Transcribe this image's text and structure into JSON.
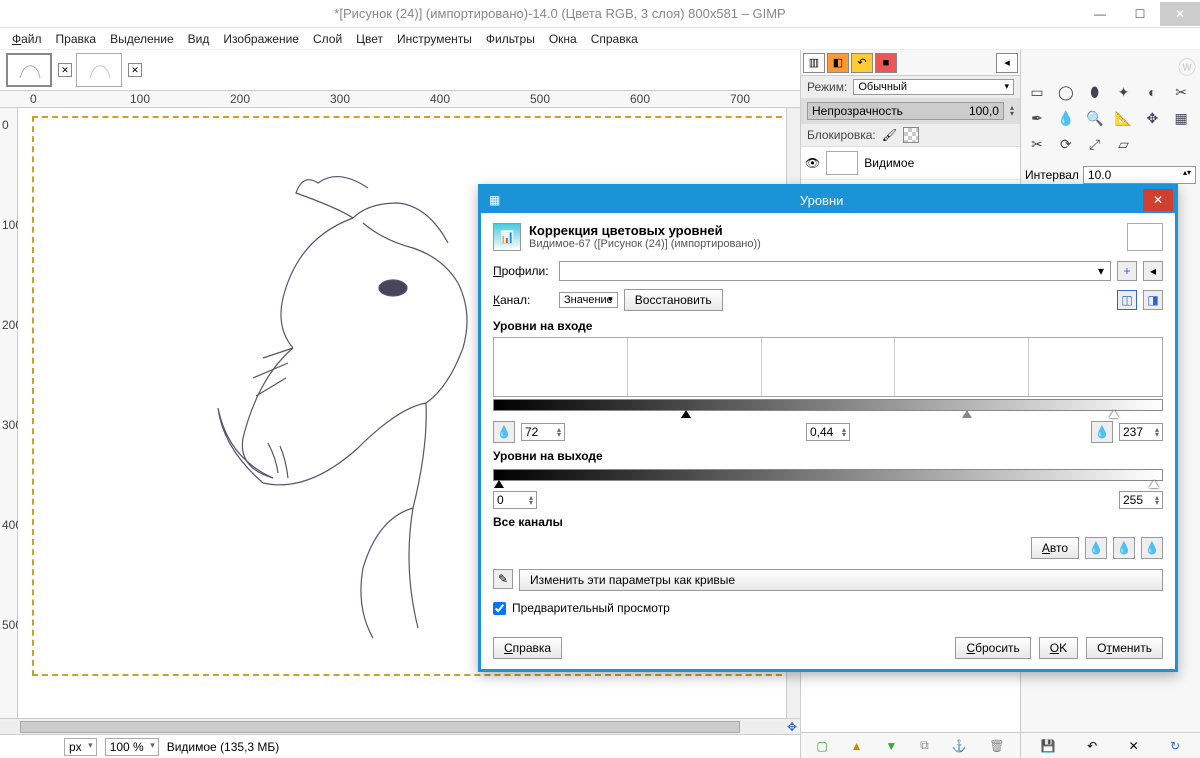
{
  "window": {
    "title": "*[Рисунок (24)] (импортировано)-14.0 (Цвета RGB, 3 слоя) 800x581 – GIMP"
  },
  "menu": {
    "file": "Файл",
    "edit": "Правка",
    "select": "Выделение",
    "view": "Вид",
    "image": "Изображение",
    "layer": "Слой",
    "color": "Цвет",
    "tools": "Инструменты",
    "filters": "Фильтры",
    "windows": "Окна",
    "help": "Справка"
  },
  "ruler": {
    "h": [
      "0",
      "100",
      "200",
      "300",
      "400",
      "500",
      "600",
      "700"
    ],
    "v": [
      "0",
      "100",
      "200",
      "300",
      "400",
      "500"
    ]
  },
  "status": {
    "unit": "px",
    "zoom": "100 %",
    "layer": "Видимое (135,3 МБ)"
  },
  "layers": {
    "modeLabel": "Режим:",
    "modeValue": "Обычный",
    "opacityLabel": "Непрозрачность",
    "opacityValue": "100,0",
    "lockLabel": "Блокировка:",
    "activeLayer": "Видимое"
  },
  "toolopts": {
    "intervalLabel": "Интервал",
    "intervalValue": "10.0"
  },
  "dialog": {
    "title": "Уровни",
    "heading": "Коррекция цветовых уровней",
    "subheading": "Видимое-67 ([Рисунок (24)] (импортировано))",
    "profilesLabel": "Профили:",
    "channelLabel": "Канал:",
    "channelValue": "Значение",
    "resetChannel": "Восстановить",
    "inputLabel": "Уровни на входе",
    "outputLabel": "Уровни на выходе",
    "lowIn": "72",
    "gamma": "0,44",
    "highIn": "237",
    "lowOut": "0",
    "highOut": "255",
    "allChannels": "Все каналы",
    "autoBtn": "Авто",
    "curvesBtn": "Изменить эти параметры как кривые",
    "preview": "Предварительный просмотр",
    "help": "Справка",
    "reset": "Сбросить",
    "ok": "OK",
    "cancel": "Отменить"
  }
}
